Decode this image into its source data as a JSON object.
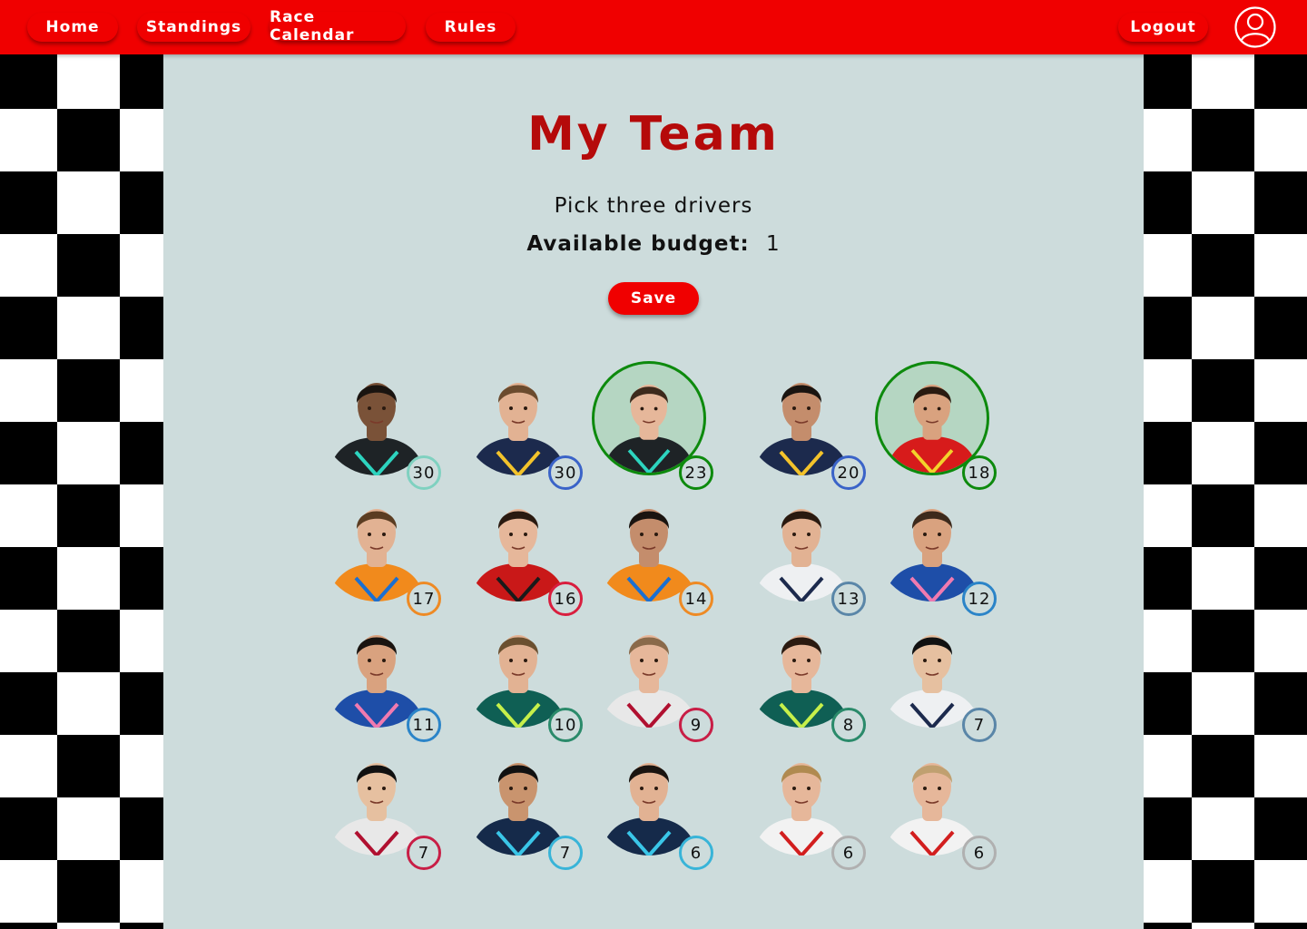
{
  "nav": {
    "home": "Home",
    "standings": "Standings",
    "race_calendar": "Race Calendar",
    "rules": "Rules",
    "logout": "Logout",
    "avatar_icon": "user-icon"
  },
  "colors": {
    "accent_red": "#f00000",
    "title_red": "#b50a0a",
    "panel_bg": "#cddcdc",
    "selected_green": "#0d8a0d"
  },
  "page": {
    "title": "My Team",
    "subtitle": "Pick three drivers",
    "budget_label": "Available budget:",
    "budget_value": "1",
    "save_label": "Save"
  },
  "drivers": [
    {
      "price": "30",
      "ring": "#7fd1c0",
      "suit": "#1e2326",
      "accent": "#2dd4bf",
      "skin": "#7a5238",
      "hair": "#1a1410",
      "selected": false
    },
    {
      "price": "30",
      "ring": "#3a63c8",
      "suit": "#1c2a4d",
      "accent": "#f3c32b",
      "skin": "#e2b293",
      "hair": "#6b4b2e",
      "selected": false
    },
    {
      "price": "23",
      "ring": "#0d8a0d",
      "suit": "#1e2326",
      "accent": "#2dd4bf",
      "skin": "#e6b79a",
      "hair": "#3d2a1c",
      "selected": true
    },
    {
      "price": "20",
      "ring": "#3a63c8",
      "suit": "#1c2a4d",
      "accent": "#f3c32b",
      "skin": "#c48d6c",
      "hair": "#1a1410",
      "selected": false
    },
    {
      "price": "18",
      "ring": "#0d8a0d",
      "suit": "#d71b1b",
      "accent": "#f3d22b",
      "skin": "#d9a27f",
      "hair": "#2a1a10",
      "selected": true
    },
    {
      "price": "17",
      "ring": "#ee8a24",
      "suit": "#f18a1c",
      "accent": "#1b6fd1",
      "skin": "#e2b293",
      "hair": "#5b3d22",
      "selected": false
    },
    {
      "price": "16",
      "ring": "#d91e3e",
      "suit": "#c91818",
      "accent": "#1a1a1a",
      "skin": "#e6b79a",
      "hair": "#2a1a10",
      "selected": false
    },
    {
      "price": "14",
      "ring": "#ee8a24",
      "suit": "#f18a1c",
      "accent": "#1b6fd1",
      "skin": "#c48d6c",
      "hair": "#1a1410",
      "selected": false
    },
    {
      "price": "13",
      "ring": "#5a86a8",
      "suit": "#eef0f2",
      "accent": "#1c2a4d",
      "skin": "#e2b293",
      "hair": "#2a1a10",
      "selected": false
    },
    {
      "price": "12",
      "ring": "#2b84c8",
      "suit": "#1e4ea8",
      "accent": "#f07ab0",
      "skin": "#d9a27f",
      "hair": "#3d2a1c",
      "selected": false
    },
    {
      "price": "11",
      "ring": "#2b84c8",
      "suit": "#1e4ea8",
      "accent": "#f07ab0",
      "skin": "#d9a27f",
      "hair": "#1a1410",
      "selected": false
    },
    {
      "price": "10",
      "ring": "#2a8a6a",
      "suit": "#0f5f54",
      "accent": "#c6f04a",
      "skin": "#e2b293",
      "hair": "#6b5030",
      "selected": false
    },
    {
      "price": "9",
      "ring": "#c81e46",
      "suit": "#e8e8e8",
      "accent": "#b01030",
      "skin": "#e6b79a",
      "hair": "#8a6a4a",
      "selected": false
    },
    {
      "price": "8",
      "ring": "#2a8a6a",
      "suit": "#0f5f54",
      "accent": "#c6f04a",
      "skin": "#e6b79a",
      "hair": "#2a1a10",
      "selected": false
    },
    {
      "price": "7",
      "ring": "#5a86a8",
      "suit": "#eef0f2",
      "accent": "#1c2a4d",
      "skin": "#e6c0a0",
      "hair": "#111111",
      "selected": false
    },
    {
      "price": "7",
      "ring": "#c81e46",
      "suit": "#e8e8e8",
      "accent": "#b01030",
      "skin": "#e6c0a0",
      "hair": "#111111",
      "selected": false
    },
    {
      "price": "7",
      "ring": "#38b4d8",
      "suit": "#152a4a",
      "accent": "#3ac6e8",
      "skin": "#c9946e",
      "hair": "#111111",
      "selected": false
    },
    {
      "price": "6",
      "ring": "#38b4d8",
      "suit": "#152a4a",
      "accent": "#3ac6e8",
      "skin": "#e2b293",
      "hair": "#1a1410",
      "selected": false
    },
    {
      "price": "6",
      "ring": "#b0b0b0",
      "suit": "#f2f2f2",
      "accent": "#d21e1e",
      "skin": "#e6b79a",
      "hair": "#b08a50",
      "selected": false
    },
    {
      "price": "6",
      "ring": "#b0b0b0",
      "suit": "#f2f2f2",
      "accent": "#d21e1e",
      "skin": "#e6b79a",
      "hair": "#c0a070",
      "selected": false
    }
  ]
}
